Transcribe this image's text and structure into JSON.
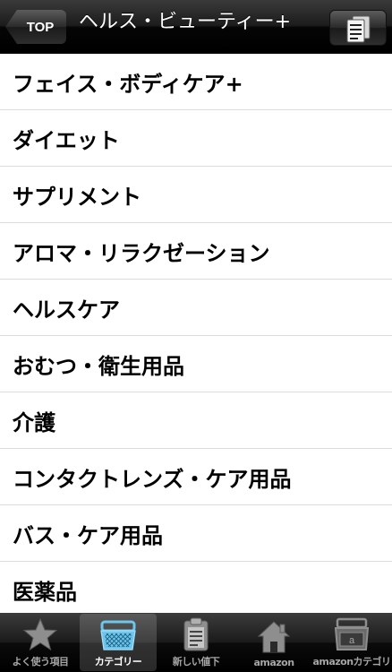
{
  "navbar": {
    "back_label": "TOP",
    "title": "ヘルス・ビューティー+",
    "doc_icon": "document-icon"
  },
  "categories": [
    "フェイス・ボディケア+",
    "ダイエット",
    "サプリメント",
    "アロマ・リラクゼーション",
    "ヘルスケア",
    "おむつ・衛生用品",
    "介護",
    "コンタクトレンズ・ケア用品",
    "バス・ケア用品",
    "医薬品"
  ],
  "tabbar": {
    "items": [
      {
        "label": "よく使う項目",
        "icon": "star-icon",
        "active": false
      },
      {
        "label": "カテゴリー",
        "icon": "basket-icon",
        "active": true
      },
      {
        "label": "新しい値下",
        "icon": "clipboard-icon",
        "active": false
      },
      {
        "label": "amazon",
        "icon": "home-icon",
        "active": false
      },
      {
        "label": "amazonカテゴリ",
        "icon": "inbox-tray-icon",
        "active": false
      }
    ]
  },
  "colors": {
    "active_tab_icon": "#6ec6ec",
    "inactive_tab_icon": "#8e8e8e"
  }
}
